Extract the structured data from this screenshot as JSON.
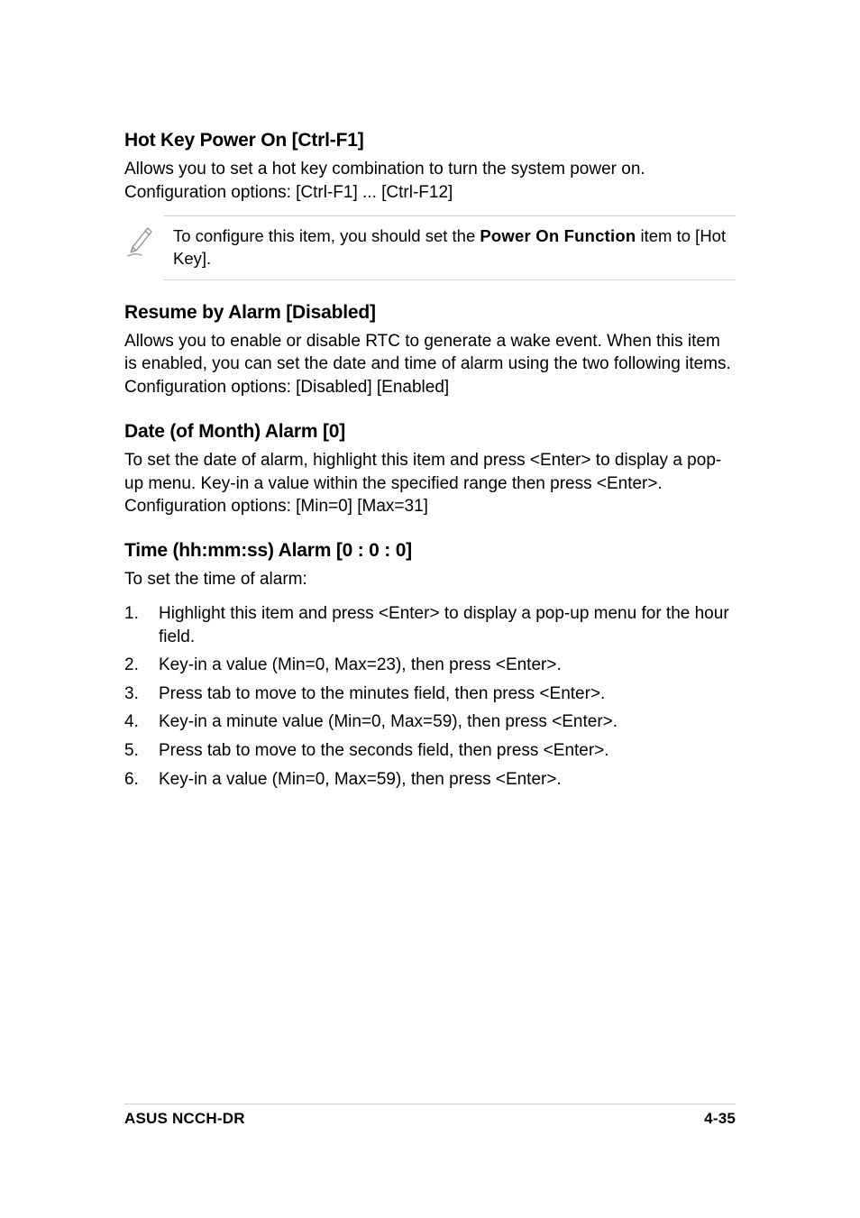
{
  "sections": {
    "hotkey": {
      "heading": "Hot Key Power On [Ctrl-F1]",
      "para": "Allows you to set a hot key combination to turn the system power on. Configuration options: [Ctrl-F1] ... [Ctrl-F12]",
      "note_prefix": "To configure this item, you should set the ",
      "note_bold": "Power On Function",
      "note_suffix": " item to [Hot Key]."
    },
    "resume": {
      "heading": "Resume by Alarm [Disabled]",
      "para": "Allows you to enable or disable RTC to generate a wake event. When this item is enabled, you can set the date and time of alarm using the two following items. Configuration options: [Disabled] [Enabled]"
    },
    "date": {
      "heading": "Date (of Month) Alarm [0]",
      "para": "To set the date of alarm, highlight this item and press <Enter> to display a pop-up menu. Key-in a value within the specified range then press <Enter>. Configuration options: [Min=0] [Max=31]"
    },
    "time": {
      "heading": "Time (hh:mm:ss) Alarm [0 : 0 : 0]",
      "intro": "To set the time of alarm:",
      "steps": [
        "Highlight this item and press <Enter> to display a pop-up menu for the hour field.",
        "Key-in a value (Min=0, Max=23), then press <Enter>.",
        "Press tab to move to the minutes field, then press <Enter>.",
        "Key-in a minute value (Min=0, Max=59), then press <Enter>.",
        "Press tab to move to the  seconds field, then press <Enter>.",
        "Key-in a value (Min=0, Max=59), then press <Enter>."
      ]
    }
  },
  "footer": {
    "left": "ASUS NCCH-DR",
    "right": "4-35"
  }
}
